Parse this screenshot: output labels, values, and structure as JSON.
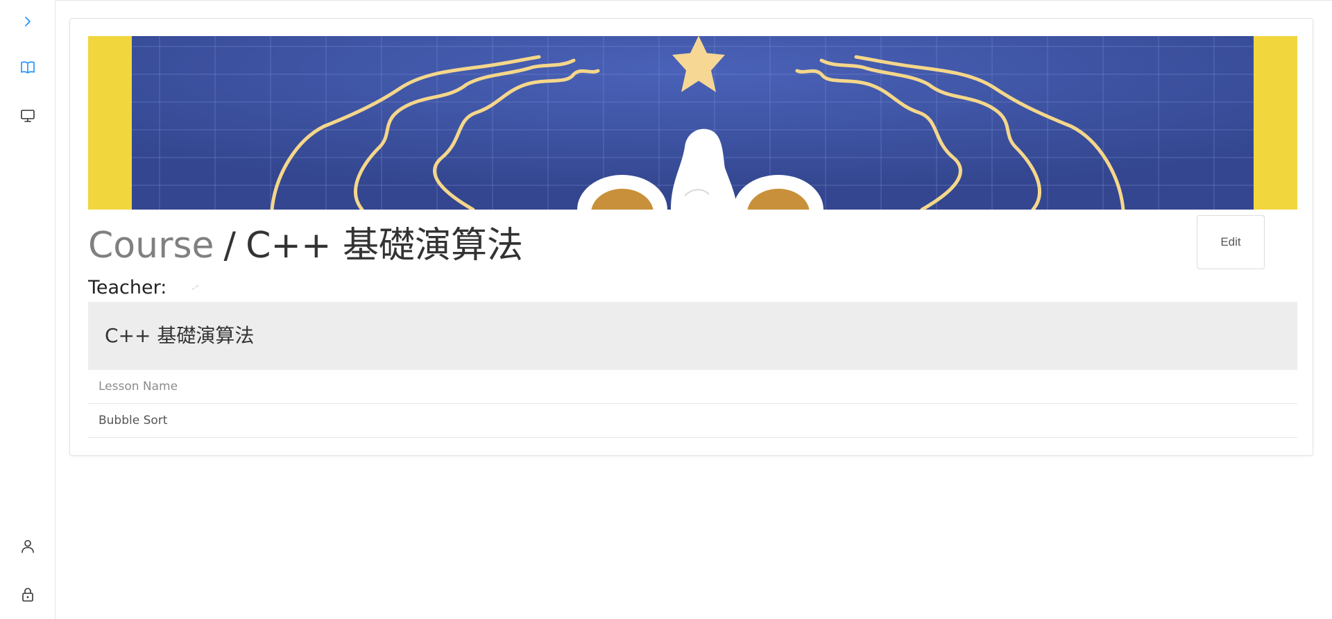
{
  "sidebar": {
    "items": [
      {
        "icon": "chevron-right-icon",
        "name": "expand-sidebar-button",
        "active": false
      },
      {
        "icon": "book-open-icon",
        "name": "sidebar-item-courses",
        "active": true
      },
      {
        "icon": "monitor-icon",
        "name": "sidebar-item-classroom",
        "active": false
      },
      {
        "icon": "user-icon",
        "name": "sidebar-item-profile",
        "active": false
      },
      {
        "icon": "lock-icon",
        "name": "sidebar-item-lock",
        "active": false
      }
    ],
    "accent_color": "#1890ff",
    "icon_color": "#333333"
  },
  "header": {
    "breadcrumb": "Course",
    "separator": "/",
    "course_title": "C++ 基礎演算法",
    "edit_label": "Edit"
  },
  "teacher": {
    "label": "Teacher:"
  },
  "section": {
    "title": "C++ 基礎演算法"
  },
  "lessons": {
    "column_header": "Lesson Name",
    "rows": [
      "Bubble Sort"
    ]
  },
  "colors": {
    "banner_blue": "#3a4fa0",
    "banner_yellow": "#f2d63e",
    "accent_gold": "#f5d78a"
  }
}
